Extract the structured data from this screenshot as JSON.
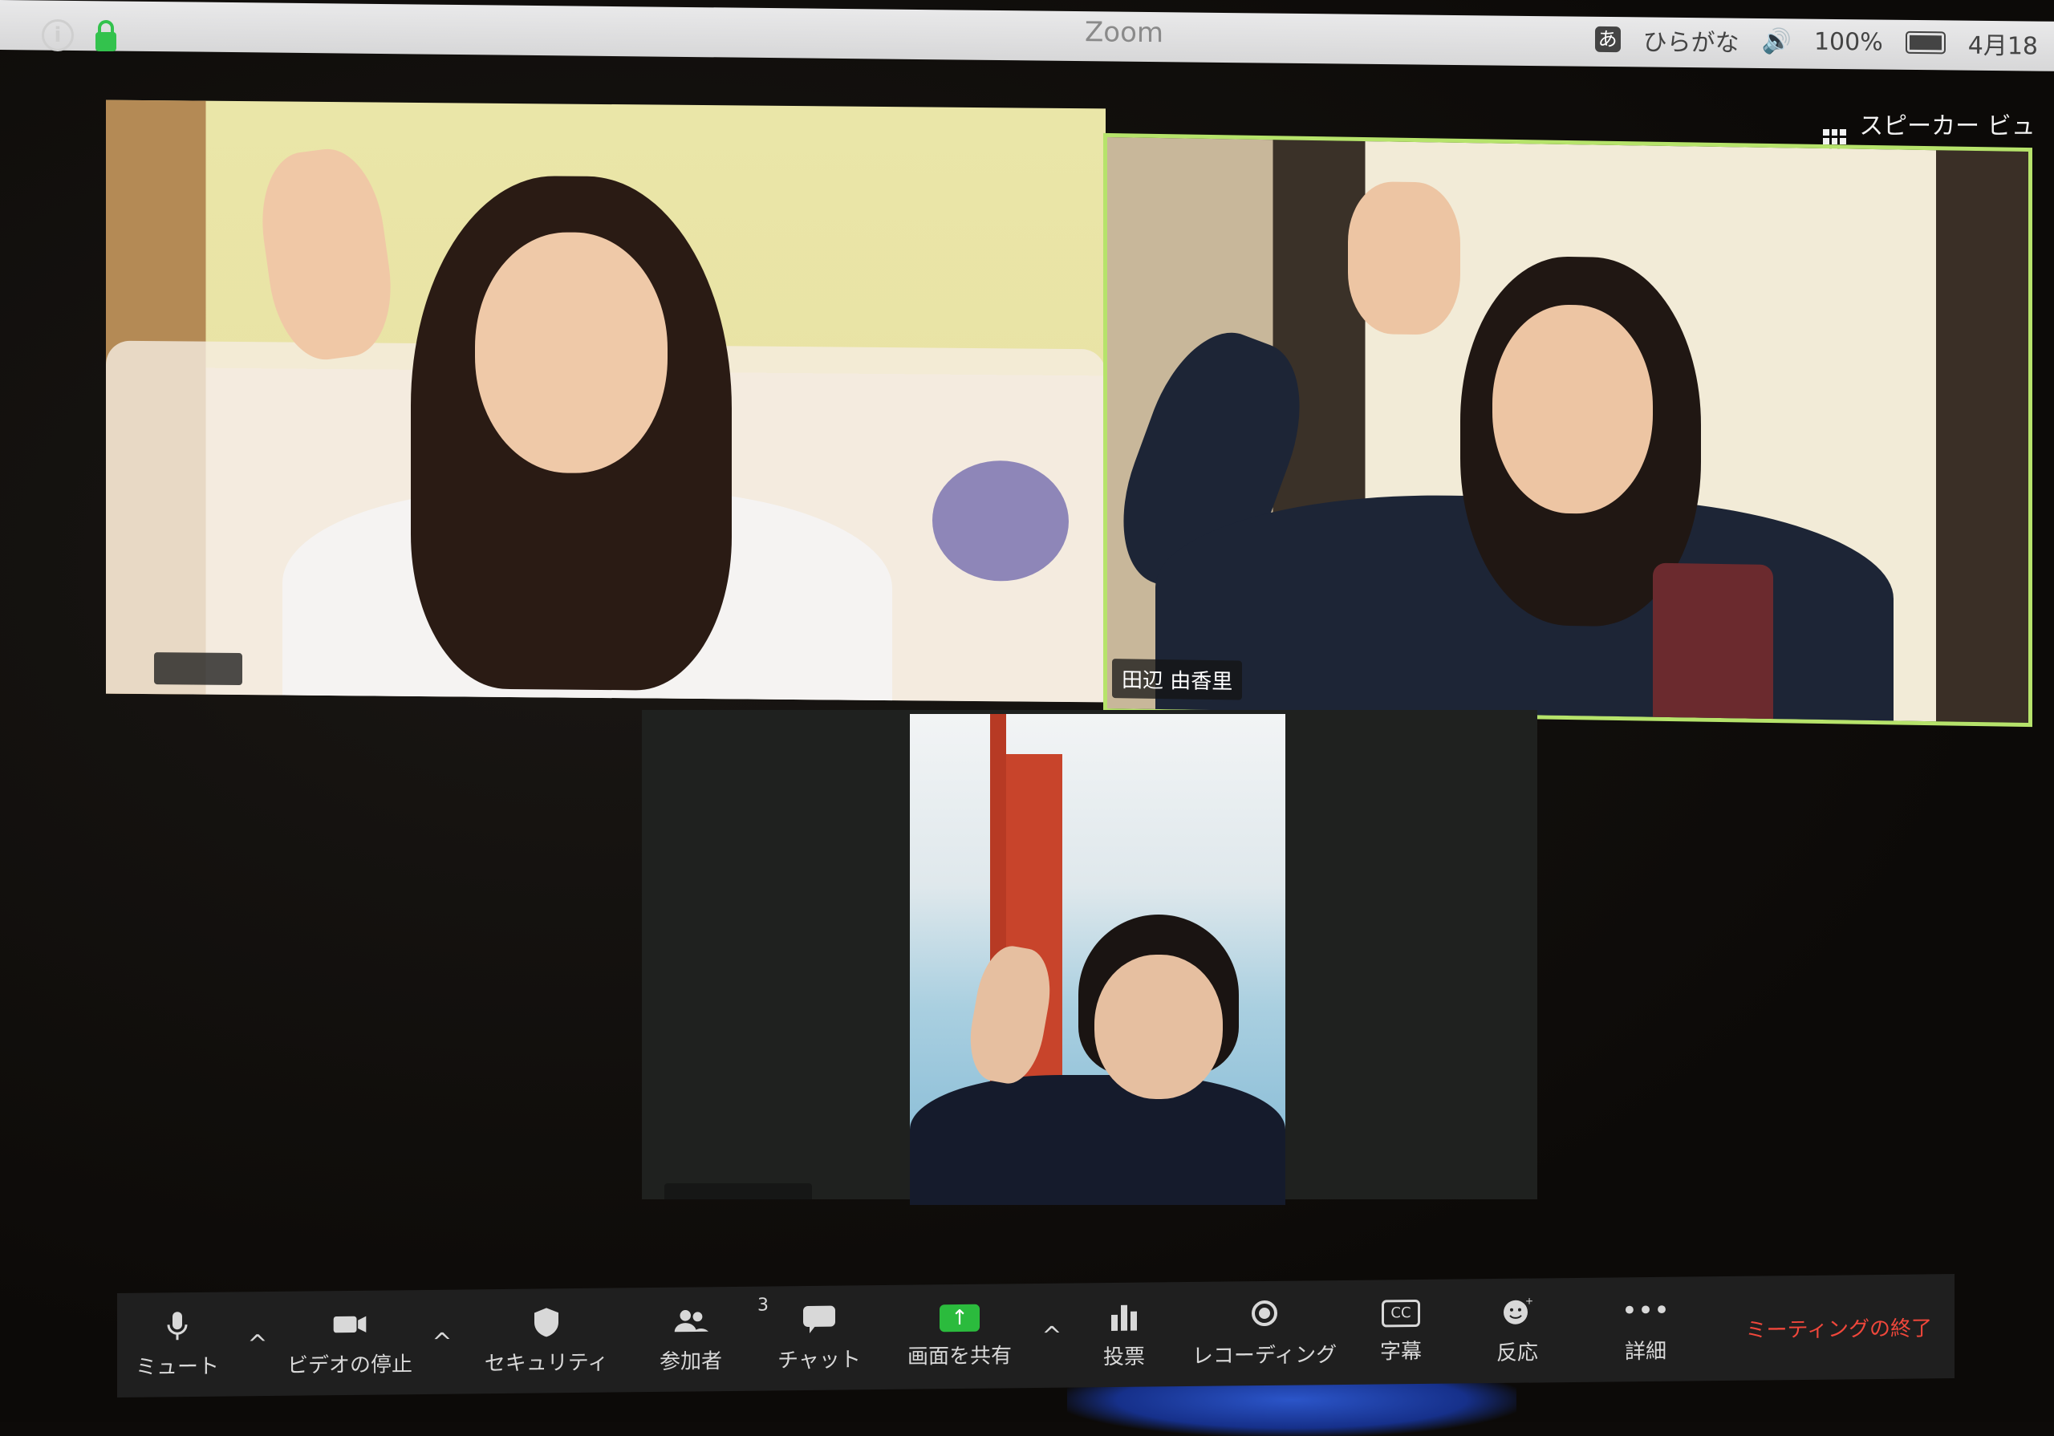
{
  "window": {
    "title": "Zoom"
  },
  "menubar": {
    "input_method_icon": "あ",
    "input_method": "ひらがな",
    "battery_percent": "100%",
    "date": "4月18"
  },
  "view": {
    "toggle_label": "スピーカー ビュー"
  },
  "participants": [
    {
      "name": ""
    },
    {
      "name": "田辺 由香里"
    },
    {
      "name": ""
    }
  ],
  "toolbar": {
    "mute_label": "ミュート",
    "video_label": "ビデオの停止",
    "security_label": "セキュリティ",
    "participants_label": "参加者",
    "participants_count": "3",
    "chat_label": "チャット",
    "share_label": "画面を共有",
    "poll_label": "投票",
    "record_label": "レコーディング",
    "captions_label": "字幕",
    "captions_icon_text": "CC",
    "reactions_label": "反応",
    "more_label": "詳細",
    "end_label": "ミーティングの終了"
  },
  "icons": {
    "info": "info-icon",
    "lock": "lock-icon",
    "grid": "grid-icon",
    "mic": "mic-icon",
    "camera": "camera-icon",
    "shield": "shield-icon",
    "people": "people-icon",
    "chat": "chat-bubble-icon",
    "share": "share-arrow-icon",
    "poll": "bar-chart-icon",
    "record": "record-icon",
    "cc": "cc-icon",
    "reaction": "smiley-icon",
    "more": "ellipsis-icon"
  },
  "colors": {
    "active_speaker_border": "#b6e36b",
    "share_button": "#2bbb3d",
    "end_meeting": "#f0473b"
  }
}
